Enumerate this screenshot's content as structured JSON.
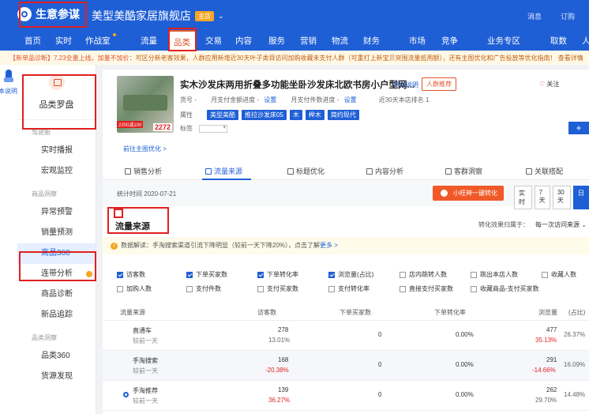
{
  "app": {
    "logo_text": "生意参谋",
    "shop_name": "美型美酷家居旗舰店",
    "shop_tag": "主店",
    "top_links": [
      "消息",
      "订购"
    ]
  },
  "nav": {
    "items": [
      {
        "label": "首页"
      },
      {
        "label": "实时"
      },
      {
        "label": "作战室"
      },
      {
        "label": "流量"
      },
      {
        "label": "品类"
      },
      {
        "label": "交易"
      },
      {
        "label": "内容"
      },
      {
        "label": "服务"
      },
      {
        "label": "营销"
      },
      {
        "label": "物流"
      },
      {
        "label": "财务"
      },
      {
        "label": "市场"
      },
      {
        "label": "竞争"
      },
      {
        "label": "业务专区"
      },
      {
        "label": "取数"
      },
      {
        "label": "人"
      }
    ],
    "active": "品类"
  },
  "notice": {
    "lead": "【新单品诊断】7.23全量上线，加量不加价：",
    "text": "可区分新老客效果，人群应用新增近30天叶子类目访问加购收藏未支付人群（可重打上新宝贝突围流量抵用额），还有主图优化和广告投放等优化指南！ 查看详情"
  },
  "rail": {
    "label": "本说明"
  },
  "sidebar": {
    "title": "品类罗盘",
    "groups": [
      {
        "label": "驾驶舱",
        "items": [
          "实时播报",
          "宏观监控"
        ]
      },
      {
        "label": "商品洞察",
        "items": [
          "异常预警",
          "销量预测",
          "商品360",
          "连带分析",
          "商品诊断",
          "新品追踪"
        ]
      },
      {
        "label": "品类洞察",
        "items": [
          "品类360",
          "货源发现"
        ]
      }
    ],
    "active": "商品360"
  },
  "product": {
    "title": "实木沙发床两用折叠多功能坐卧沙发床北欧书房小户型网...",
    "eval_link": "评分说明",
    "crowd_btn": "人群推荐",
    "follow": "关注",
    "image_price": "2272",
    "image_promo": "2200减100",
    "row1": {
      "huohao_label": "货号 -",
      "pay_goal_label": "月支付金额进度 -",
      "pay_goal_link": "设置",
      "pay_count_label": "月支付件数进度 -",
      "pay_count_link": "设置",
      "rank_label": "近30天本店排名 1"
    },
    "attr_label": "属性",
    "attrs": [
      "美型美酷",
      "推拉沙发床05",
      "木",
      "榉木",
      "简约现代"
    ],
    "label_label": "标签",
    "optimize_link": "前往主图优化 >"
  },
  "tabs": [
    {
      "label": "销售分析",
      "icon": "sales-icon"
    },
    {
      "label": "流量来源",
      "icon": "traffic-icon"
    },
    {
      "label": "标题优化",
      "icon": "title-icon"
    },
    {
      "label": "内容分析",
      "icon": "content-icon"
    },
    {
      "label": "客群洞察",
      "icon": "customer-icon"
    },
    {
      "label": "关联搭配",
      "icon": "link-icon"
    }
  ],
  "tabs_active": "流量来源",
  "stat": {
    "time_label": "统计时间 2020-07-21",
    "convert_btn": "小旺神一键转化",
    "ranges": [
      "实时",
      "7天",
      "30天",
      "日"
    ],
    "range_active": "日"
  },
  "traffic": {
    "section_title": "流量来源",
    "attr_label": "转化效果归属于：",
    "attr_value": "每一次访问来源",
    "tip_text": "数据解读：手淘搜索渠道引流下降明显（较前一天下降20%），点击了解",
    "tip_link": "更多 >",
    "checkboxes": [
      {
        "label": "访客数",
        "checked": true
      },
      {
        "label": "下单买家数",
        "checked": true
      },
      {
        "label": "下单转化率",
        "checked": true
      },
      {
        "label": "浏览量(占比)",
        "checked": true
      },
      {
        "label": "店内跳转人数",
        "checked": false
      },
      {
        "label": "跳出本店人数",
        "checked": false
      },
      {
        "label": "收藏人数",
        "checked": false
      },
      {
        "label": "加购人数",
        "checked": false
      },
      {
        "label": "支付件数",
        "checked": false
      },
      {
        "label": "支付买家数",
        "checked": false
      },
      {
        "label": "支付转化率",
        "checked": false
      },
      {
        "label": "直接支付买家数",
        "checked": false
      },
      {
        "label": "收藏商品-支付买家数",
        "checked": false
      }
    ],
    "columns": [
      "流量来源",
      "访客数",
      "下单买家数",
      "下单转化率",
      "浏览量",
      "(占比)"
    ],
    "rows": [
      {
        "source": "直通车",
        "sub": "较前一天",
        "visitors": "278",
        "visitors_cmp": "13.01%",
        "orders": "0",
        "rate": "0.00%",
        "pv": "477",
        "pv_cmp": "35.13%",
        "share": "26.37%"
      },
      {
        "source": "手淘搜索",
        "sub": "较前一天",
        "visitors": "168",
        "visitors_cmp": "-20.38%",
        "orders": "0",
        "rate": "0.00%",
        "pv": "291",
        "pv_cmp": "-14.66%",
        "share": "16.09%"
      },
      {
        "source": "手淘推荐",
        "sub": "较前一天",
        "visitors": "139",
        "visitors_cmp": "36.27%",
        "orders": "0",
        "rate": "0.00%",
        "pv": "262",
        "pv_cmp": "29.70%",
        "share": "14.48%"
      }
    ]
  },
  "colors": {
    "brand": "#1f5fd6",
    "accent": "#e0532a",
    "highlight_box": "#e02020"
  }
}
